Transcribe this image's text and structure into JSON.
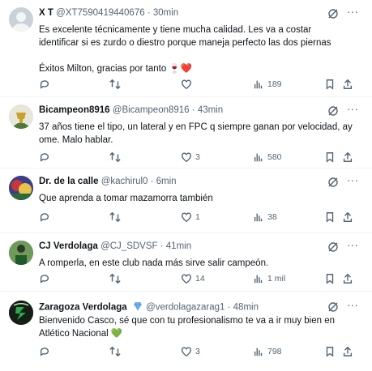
{
  "tweets": [
    {
      "name": "X T",
      "handle": "@XT7590419440676",
      "time": "30min",
      "lines": [
        "Es excelente técnicamente y tiene mucha calidad. Les va a costar",
        "identificar si es zurdo o diestro porque maneja perfecto las dos piernas",
        "",
        "Éxitos Milton, gracias por tanto 🍷❤️"
      ],
      "replies": "",
      "retweets": "",
      "likes": "",
      "views": "189"
    },
    {
      "name": "Bicampeon8916",
      "handle": "@Bicampeon8916",
      "time": "43min",
      "lines": [
        "37 años tiene el tipo, un lateral y en FPC q siempre ganan por velocidad, ay",
        "ome. Malo hablar."
      ],
      "replies": "",
      "retweets": "",
      "likes": "3",
      "views": "580"
    },
    {
      "name": "Dr. de la calle",
      "handle": "@kachirul0",
      "time": "6min",
      "lines": [
        "Que aprenda a tomar mazamorra también"
      ],
      "replies": "",
      "retweets": "",
      "likes": "1",
      "views": "38"
    },
    {
      "name": "CJ Verdolaga",
      "handle": "@CJ_SDVSF",
      "time": "41min",
      "lines": [
        "A romperla, en este club nada más sirve salir campeón."
      ],
      "replies": "",
      "retweets": "",
      "likes": "14",
      "views": "1 mil"
    },
    {
      "name": "Zaragoza Verdolaga",
      "handle": "@verdolagazarag1",
      "time": "48min",
      "lines": [
        "Bienvenido Casco, sé que con tu profesionalismo te va a ir muy bien en",
        "Atlético Nacional 💚"
      ],
      "replies": "",
      "retweets": "",
      "likes": "3",
      "views": "798"
    }
  ],
  "colors": {
    "text": "#0f1419",
    "muted": "#536471",
    "divider": "#eff3f4",
    "heart": "#e0245e",
    "verified": "#7bb3f0"
  }
}
